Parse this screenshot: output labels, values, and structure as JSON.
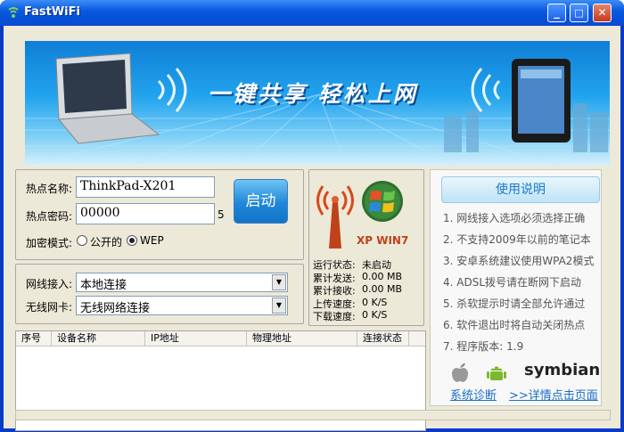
{
  "window": {
    "title": "FastWiFi",
    "min": "_",
    "max": "□",
    "close": "✕"
  },
  "banner": {
    "slogan": "一键共享  轻松上网"
  },
  "hotspot": {
    "name_label": "热点名称:",
    "name_value": "ThinkPad-X201",
    "password_label": "热点密码:",
    "password_value": "00000",
    "password_length": "5",
    "start_button": "启动",
    "encryption_label": "加密模式:",
    "encryption_options": [
      "公开的",
      "WEP"
    ],
    "encryption_selected": "WEP"
  },
  "connection": {
    "wired_label": "网线接入:",
    "wired_value": "本地连接",
    "wireless_label": "无线网卡:",
    "wireless_value": "无线网络连接"
  },
  "status": {
    "os_badge": "XP WIN7",
    "run_state_label": "运行状态:",
    "run_state_value": "未启动",
    "sent_label": "累计发送:",
    "sent_value": "0.00 MB",
    "recv_label": "累计接收:",
    "recv_value": "0.00 MB",
    "upload_label": "上传速度:",
    "upload_value": "0 K/S",
    "download_label": "下载速度:",
    "download_value": "0 K/S"
  },
  "devices": {
    "columns": [
      "序号",
      "设备名称",
      "IP地址",
      "物理地址",
      "连接状态"
    ]
  },
  "help": {
    "title": "使用说明",
    "items": [
      "1. 网线接入选项必须选择正确",
      "2. 不支持2009年以前的笔记本",
      "3. 安卓系统建议使用WPA2模式",
      "4. ADSL拨号请在断网下启动",
      "5. 杀软提示时请全部允许通过",
      "6. 软件退出时将自动关闭热点",
      "7. 程序版本: 1.9"
    ],
    "brand_symbian": "symbian",
    "link_diagnose": "系统诊断",
    "link_details": ">>详情点击页面"
  },
  "colors": {
    "accent": "#1a6fc8",
    "title_bar": "#0a5be0",
    "panel_bg": "#ece9d8",
    "wifi_orange": "#d8481a"
  }
}
